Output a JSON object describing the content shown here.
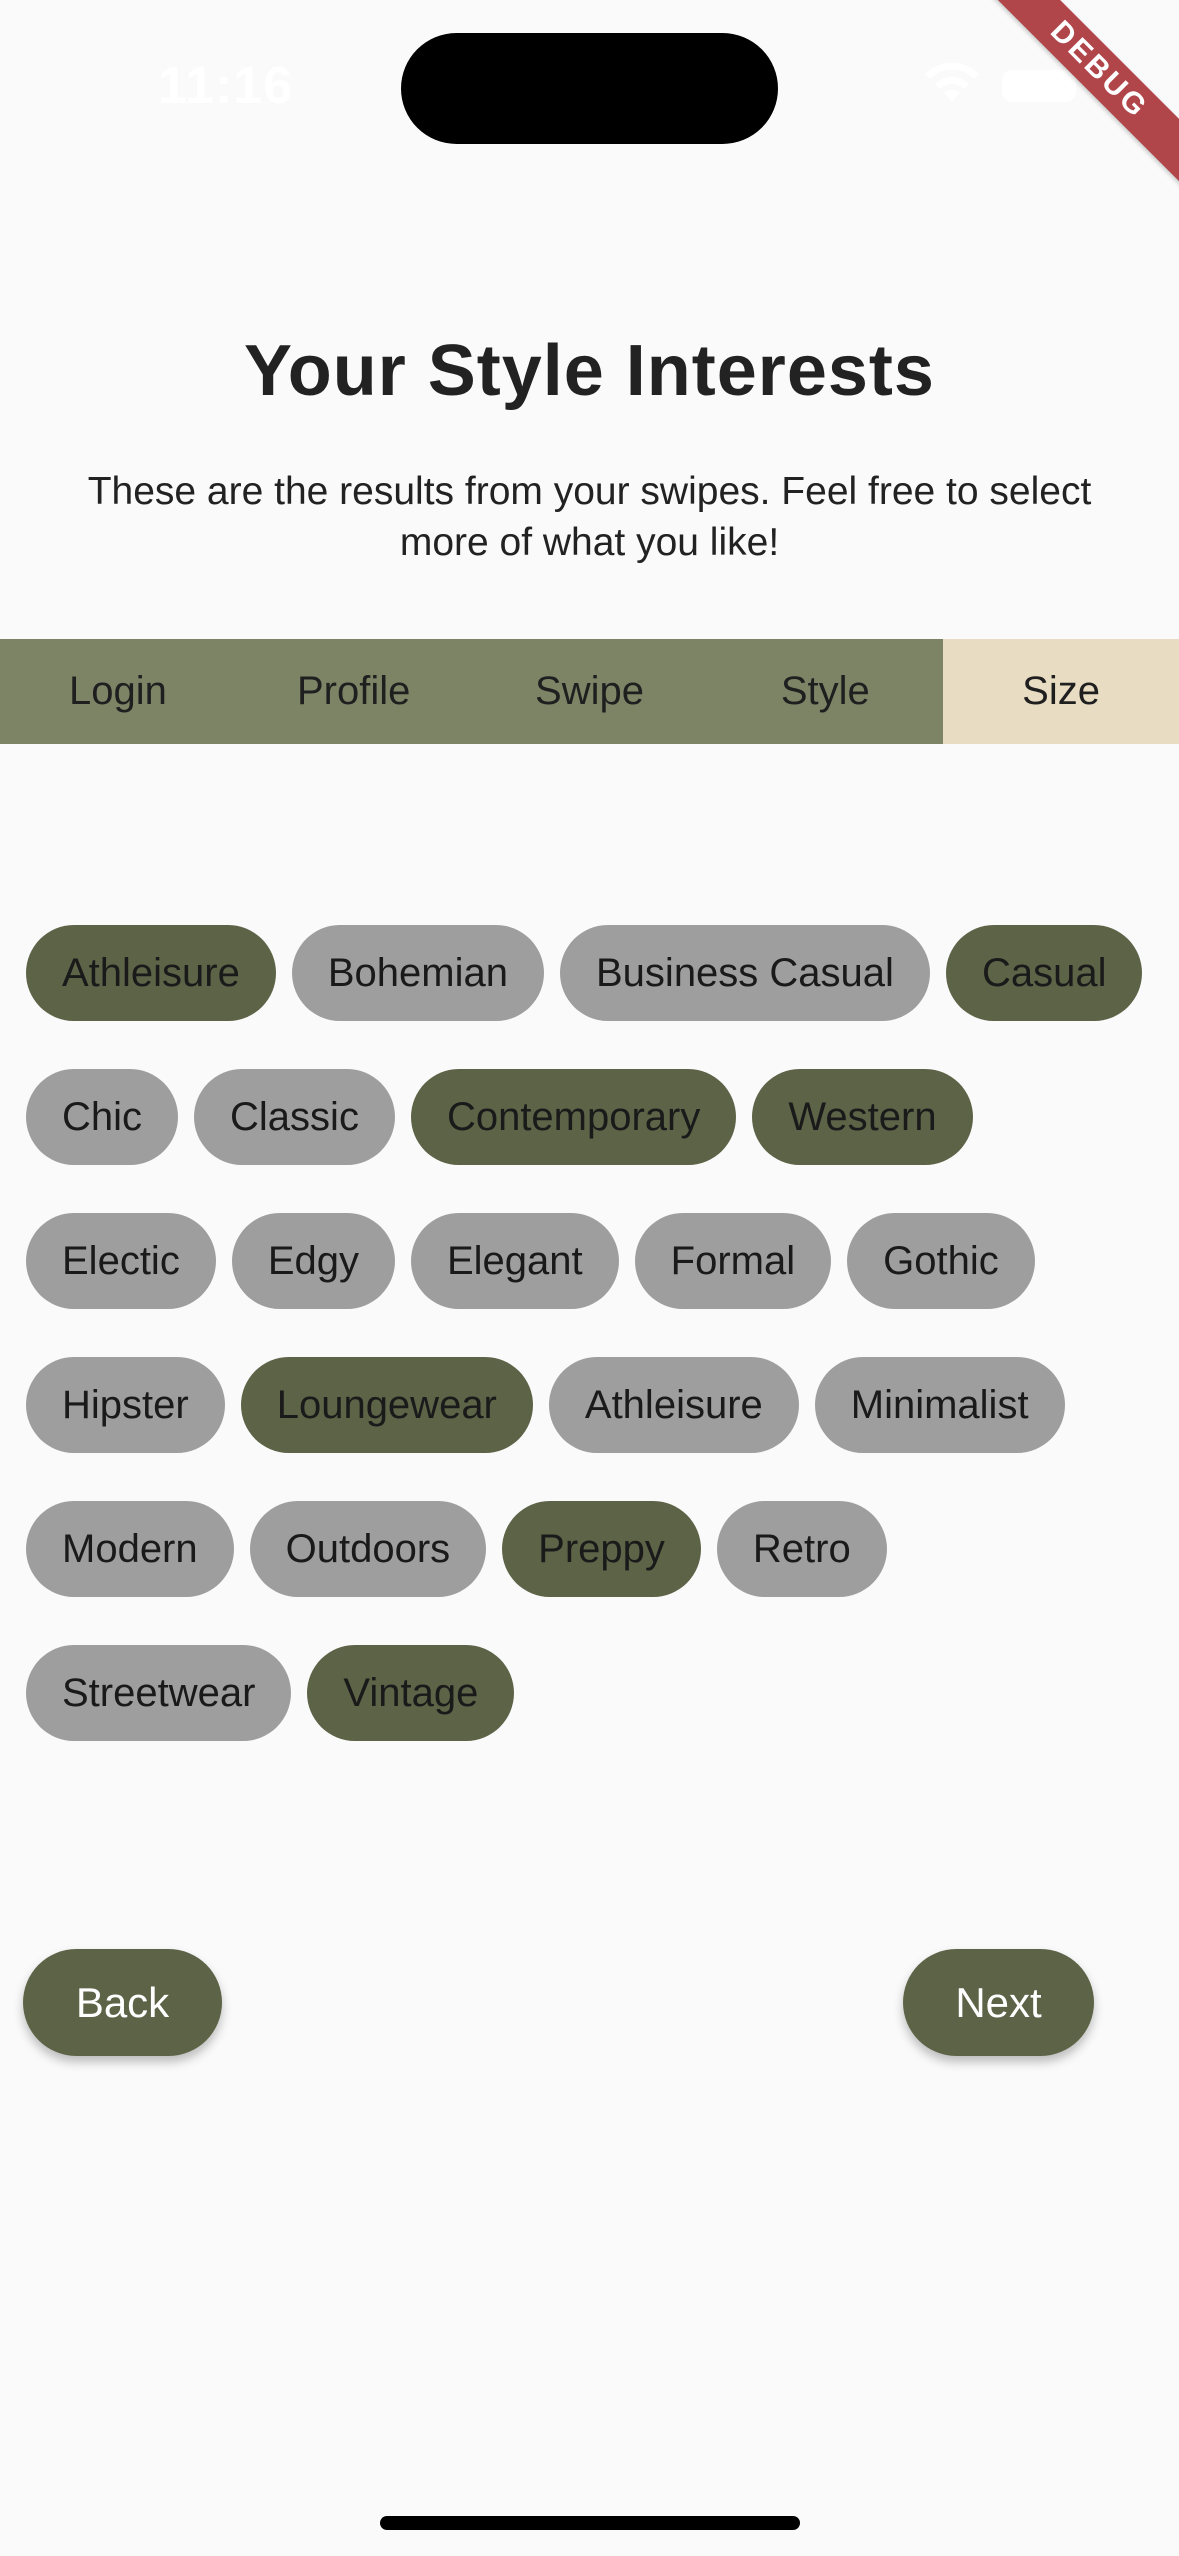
{
  "status_bar": {
    "time": "11:16",
    "debug_label": "DEBUG"
  },
  "header": {
    "title": "Your Style Interests",
    "subtitle": "These are the results from your swipes. Feel free to select more of what you like!"
  },
  "steps": [
    {
      "label": "Login",
      "active": false
    },
    {
      "label": "Profile",
      "active": false
    },
    {
      "label": "Swipe",
      "active": false
    },
    {
      "label": "Style",
      "active": false
    },
    {
      "label": "Size",
      "active": true
    }
  ],
  "styles": [
    {
      "label": "Athleisure",
      "selected": true
    },
    {
      "label": "Bohemian",
      "selected": false
    },
    {
      "label": "Business Casual",
      "selected": false
    },
    {
      "label": "Casual",
      "selected": true
    },
    {
      "label": "Chic",
      "selected": false
    },
    {
      "label": "Classic",
      "selected": false
    },
    {
      "label": "Contemporary",
      "selected": true
    },
    {
      "label": "Western",
      "selected": true
    },
    {
      "label": "Electic",
      "selected": false
    },
    {
      "label": "Edgy",
      "selected": false
    },
    {
      "label": "Elegant",
      "selected": false
    },
    {
      "label": "Formal",
      "selected": false
    },
    {
      "label": "Gothic",
      "selected": false
    },
    {
      "label": "Hipster",
      "selected": false
    },
    {
      "label": "Loungewear",
      "selected": true
    },
    {
      "label": "Athleisure",
      "selected": false
    },
    {
      "label": "Minimalist",
      "selected": false
    },
    {
      "label": "Modern",
      "selected": false
    },
    {
      "label": "Outdoors",
      "selected": false
    },
    {
      "label": "Preppy",
      "selected": true
    },
    {
      "label": "Retro",
      "selected": false
    },
    {
      "label": "Streetwear",
      "selected": false
    },
    {
      "label": "Vintage",
      "selected": true
    }
  ],
  "buttons": {
    "back_label": "Back",
    "next_label": "Next"
  },
  "colors": {
    "accent_dark": "#5d6347",
    "step_bar": "#7d8466",
    "step_active": "#e8dcc2",
    "chip_unselected": "#9e9e9e",
    "background": "#fafafa"
  }
}
